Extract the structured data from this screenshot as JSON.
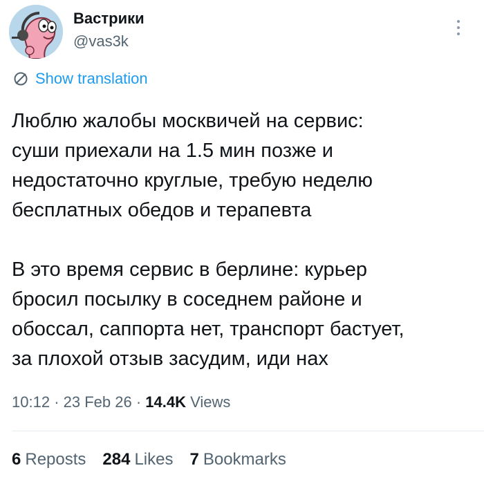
{
  "author": {
    "display_name": "Вастрики",
    "handle": "@vas3k",
    "avatar_icon": "cartoon-worm-avatar-icon"
  },
  "more_icon": "more-vertical-icon",
  "translation": {
    "icon": "globe-translate-icon",
    "label": "Show translation"
  },
  "tweet": {
    "paragraphs": [
      {
        "lines": [
          "Люблю жалобы москвичей на сервис:",
          "суши приехали на 1.5 мин позже и",
          "недостаточно круглые, требую неделю",
          "бесплатных обедов и терапевта"
        ]
      },
      {
        "lines": [
          "В это время сервис в берлине: курьер",
          "бросил посылку в соседнем районе и",
          "обоссал, саппорта нет, транспорт бастует,",
          "за плохой отзыв засудим, иди нах"
        ]
      }
    ]
  },
  "meta": {
    "time": "10:12",
    "separator": "·",
    "date": "23 Feb 26",
    "views_count": "14.4K",
    "views_label": "Views"
  },
  "stats": {
    "reposts_count": "6",
    "reposts_label": "Reposts",
    "likes_count": "284",
    "likes_label": "Likes",
    "bookmarks_count": "7",
    "bookmarks_label": "Bookmarks"
  },
  "colors": {
    "text_primary": "#0f1419",
    "text_secondary": "#536471",
    "accent": "#1d9bf0",
    "divider": "#e6ecf0"
  }
}
